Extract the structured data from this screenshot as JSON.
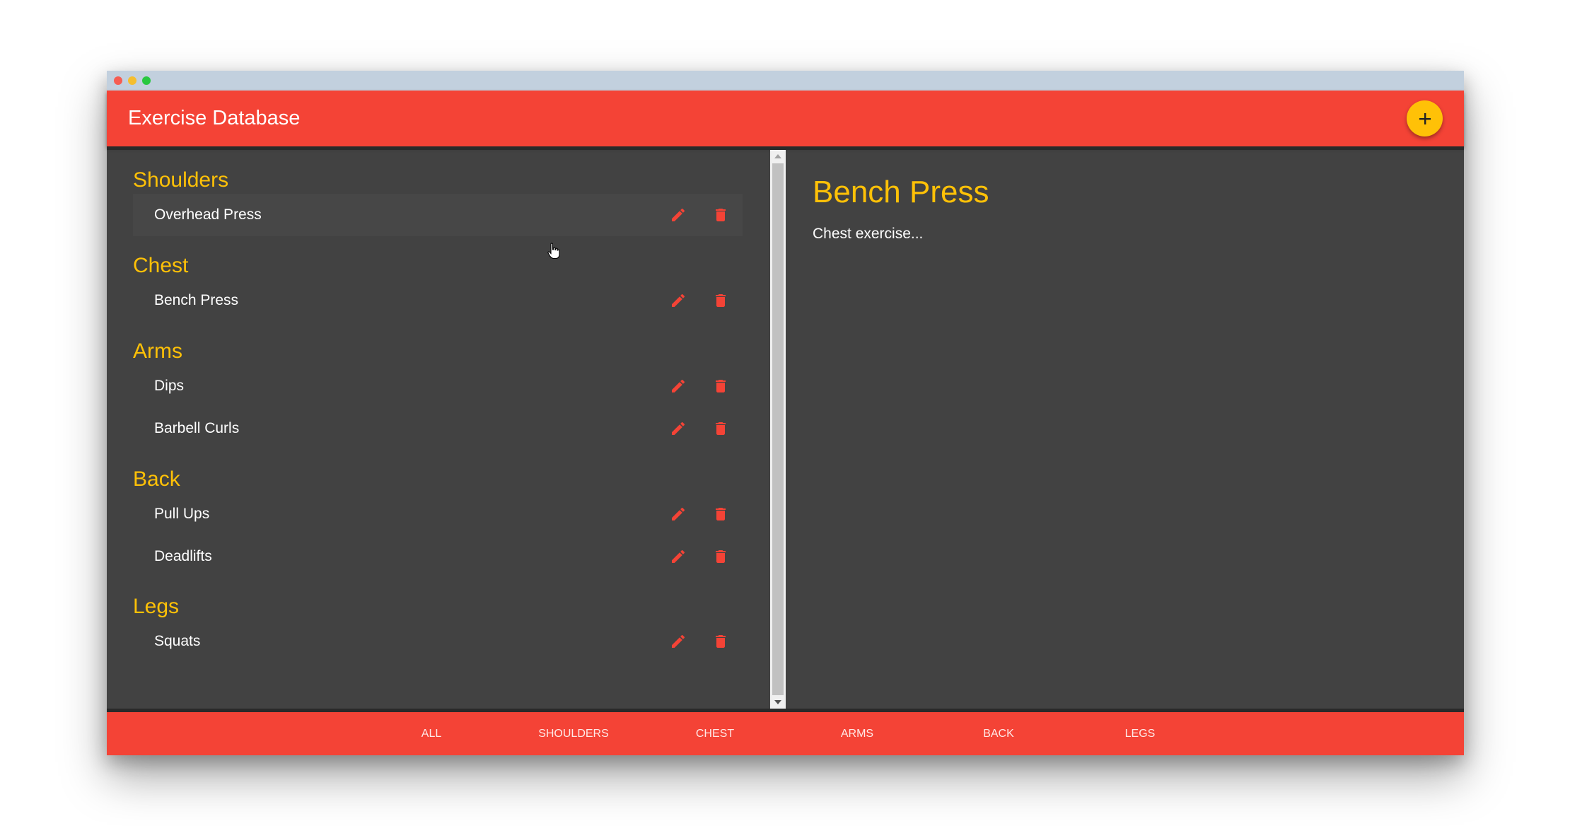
{
  "app": {
    "title": "Exercise Database",
    "add_button_icon": "plus-icon"
  },
  "colors": {
    "primary": "#f44336",
    "accent": "#ffc107",
    "background": "#424242"
  },
  "exercises": {
    "groups": [
      {
        "name": "Shoulders",
        "items": [
          {
            "label": "Overhead Press"
          }
        ]
      },
      {
        "name": "Chest",
        "items": [
          {
            "label": "Bench Press"
          }
        ]
      },
      {
        "name": "Arms",
        "items": [
          {
            "label": "Dips"
          },
          {
            "label": "Barbell Curls"
          }
        ]
      },
      {
        "name": "Back",
        "items": [
          {
            "label": "Pull Ups"
          },
          {
            "label": "Deadlifts"
          }
        ]
      },
      {
        "name": "Legs",
        "items": [
          {
            "label": "Squats"
          }
        ]
      }
    ],
    "row_actions": {
      "edit_icon": "pencil-icon",
      "delete_icon": "trash-icon"
    }
  },
  "detail": {
    "title": "Bench Press",
    "description": "Chest exercise..."
  },
  "tabs": [
    {
      "label": "ALL"
    },
    {
      "label": "SHOULDERS"
    },
    {
      "label": "CHEST"
    },
    {
      "label": "ARMS"
    },
    {
      "label": "BACK"
    },
    {
      "label": "LEGS"
    }
  ]
}
